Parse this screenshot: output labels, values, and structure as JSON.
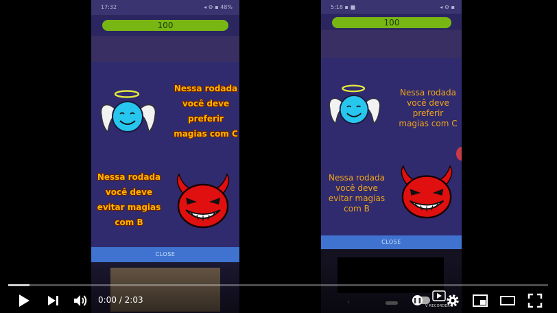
{
  "player": {
    "current_time": "0:00",
    "separator": "/",
    "duration": "2:03",
    "progress": 0.04,
    "watermark": "V RECORDER"
  },
  "left_phone": {
    "statusbar_left": "17:32",
    "statusbar_right": "◂ ⚙ ▪ 48%",
    "hp_value": "100",
    "angel_text": [
      "Nessa rodada",
      "você deve",
      "preferir",
      "magias com C"
    ],
    "devil_text": [
      "Nessa rodada",
      "você deve",
      "evitar magias",
      "com B"
    ],
    "close_label": "CLOSE"
  },
  "right_phone": {
    "statusbar_left": "5:18 ▪ ■",
    "statusbar_right": "◂ ⚙ ▪",
    "hp_value": "100",
    "angel_text": [
      "Nessa rodada",
      "você deve",
      "preferir",
      "magias com C"
    ],
    "devil_text": [
      "Nessa rodada",
      "você deve",
      "evitar magias",
      "com B"
    ],
    "close_label": "CLOSE"
  },
  "icons": {
    "play": "play-icon",
    "next": "next-icon",
    "volume": "volume-icon",
    "subtitles": "subtitles-icon",
    "settings": "gear-icon",
    "miniplayer": "miniplayer-icon",
    "theater": "theater-icon",
    "fullscreen": "fullscreen-icon"
  },
  "colors": {
    "dialog_bg": "#302b6e",
    "hp_bar": "#78b614",
    "close_button": "#3f73cf",
    "text_accent": "#ffb400"
  }
}
